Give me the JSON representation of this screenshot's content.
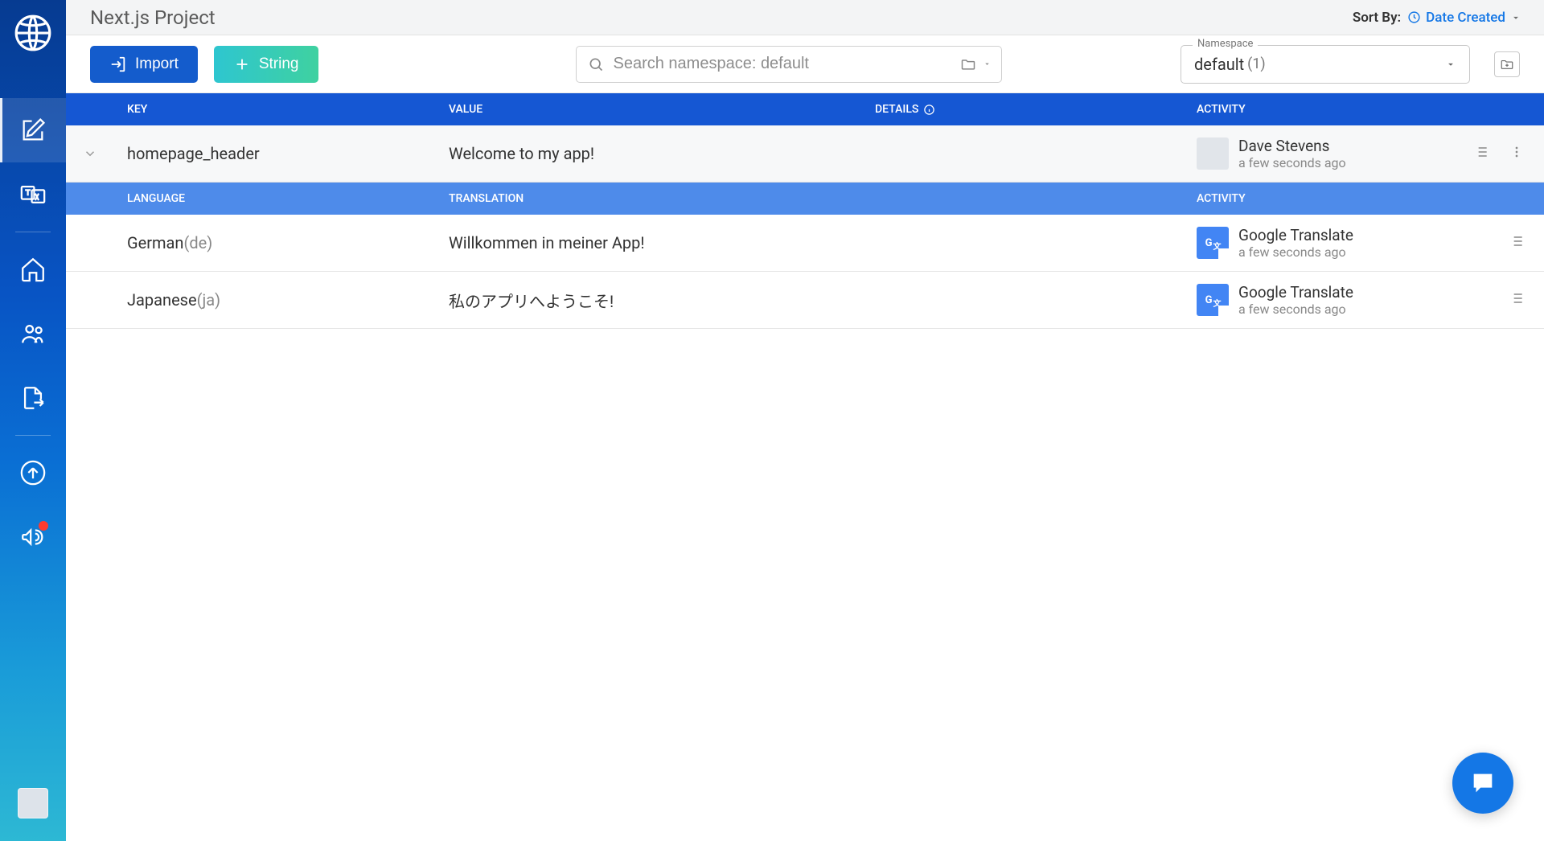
{
  "header": {
    "project_title": "Next.js Project",
    "sort_label": "Sort By:",
    "sort_value": "Date Created"
  },
  "toolbar": {
    "import_label": "Import",
    "string_label": "String",
    "search_placeholder": "Search namespace: default",
    "namespace_label": "Namespace",
    "namespace_value": "default",
    "namespace_count": "(1)"
  },
  "columns": {
    "key": "KEY",
    "value": "VALUE",
    "details": "DETAILS",
    "activity": "ACTIVITY"
  },
  "subcolumns": {
    "language": "LANGUAGE",
    "translation": "TRANSLATION",
    "activity": "ACTIVITY"
  },
  "key_row": {
    "key": "homepage_header",
    "value": "Welcome to my app!",
    "author": "Dave Stevens",
    "time": "a few seconds ago"
  },
  "translations": [
    {
      "language": "German",
      "code": "(de)",
      "value": "Willkommen in meiner App!",
      "author": "Google Translate",
      "time": "a few seconds ago"
    },
    {
      "language": "Japanese",
      "code": "(ja)",
      "value": "私のアプリへようこそ!",
      "author": "Google Translate",
      "time": "a few seconds ago"
    }
  ]
}
